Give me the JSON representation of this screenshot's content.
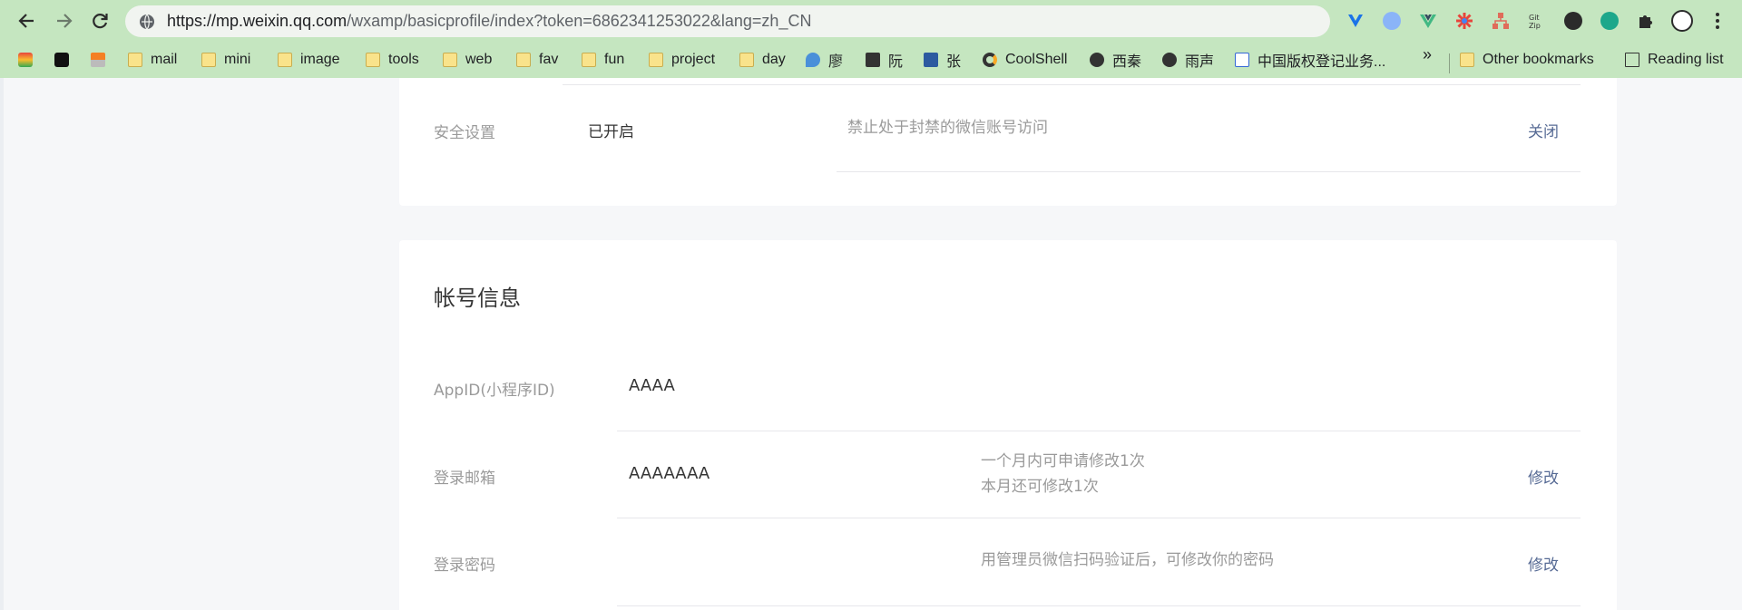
{
  "browser": {
    "url_host": "https://mp.weixin.qq.com",
    "url_rest": "/wxamp/basicprofile/index?token=6862341253022&lang=zh_CN",
    "bookmarks": [
      {
        "label": "mail"
      },
      {
        "label": "mini"
      },
      {
        "label": "image"
      },
      {
        "label": "tools"
      },
      {
        "label": "web"
      },
      {
        "label": "fav"
      },
      {
        "label": "fun"
      },
      {
        "label": "project"
      },
      {
        "label": "day"
      },
      {
        "label": "廖"
      },
      {
        "label": "阮"
      },
      {
        "label": "张"
      },
      {
        "label": "CoolShell"
      },
      {
        "label": "西秦"
      },
      {
        "label": "雨声"
      },
      {
        "label": "中国版权登记业务..."
      }
    ],
    "overflow_label": "»",
    "other_bookmarks": "Other bookmarks",
    "reading_list": "Reading list"
  },
  "security_card": {
    "label": "安全设置",
    "status": "已开启",
    "description": "禁止处于封禁的微信账号访问",
    "action": "关闭"
  },
  "account_card": {
    "title": "帐号信息",
    "rows": [
      {
        "label": "AppID(小程序ID)",
        "value": "AAAA"
      },
      {
        "label": "登录邮箱",
        "value": "AAAAAAA",
        "desc_line1": "一个月内可申请修改1次",
        "desc_line2": "本月还可修改1次",
        "action": "修改"
      },
      {
        "label": "登录密码",
        "value": "",
        "desc_line1": "用管理员微信扫码验证后，可修改你的密码",
        "action": "修改"
      }
    ]
  }
}
